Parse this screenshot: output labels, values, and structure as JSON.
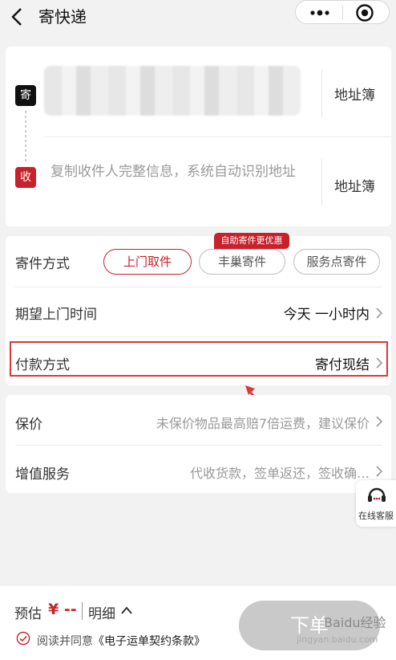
{
  "header": {
    "title": "寄快递"
  },
  "address": {
    "address_book_label": "地址簿",
    "recipient_placeholder": "复制收件人完整信息，系统自动识别地址",
    "sender_badge": "寄",
    "recipient_badge": "收"
  },
  "shipping_method": {
    "label": "寄件方式",
    "options": [
      "上门取件",
      "丰巢寄件",
      "服务点寄件"
    ],
    "selected": "上门取件",
    "promo": "自助寄件更优惠"
  },
  "pickup_time": {
    "label": "期望上门时间",
    "value": "今天 一小时内"
  },
  "payment": {
    "label": "付款方式",
    "value": "寄付现结"
  },
  "insurance": {
    "label": "保价",
    "hint": "未保价物品最高赔7倍运费，建议保价"
  },
  "value_added": {
    "label": "增值服务",
    "hint": "代收货款，签单返还，签收确…"
  },
  "customer_service": {
    "label": "在线客服"
  },
  "footer": {
    "estimate_label": "预估",
    "estimate_value": "¥ --",
    "detail_label": "明细",
    "agree_prefix": "阅读并同意",
    "agree_link": "《电子运单契约条款》",
    "submit_label": "下单",
    "watermark_top": "Baidu经验",
    "watermark": "jingyan.baidu.com"
  },
  "colors": {
    "accent": "#c8212b",
    "background": "#f2f2f2",
    "annotation": "#d9393b"
  },
  "icons": [
    "back-arrow-icon",
    "more-icon",
    "target-icon",
    "chevron-right-icon",
    "headset-icon",
    "check-icon",
    "chevron-up-icon",
    "annotation-arrow-icon"
  ]
}
